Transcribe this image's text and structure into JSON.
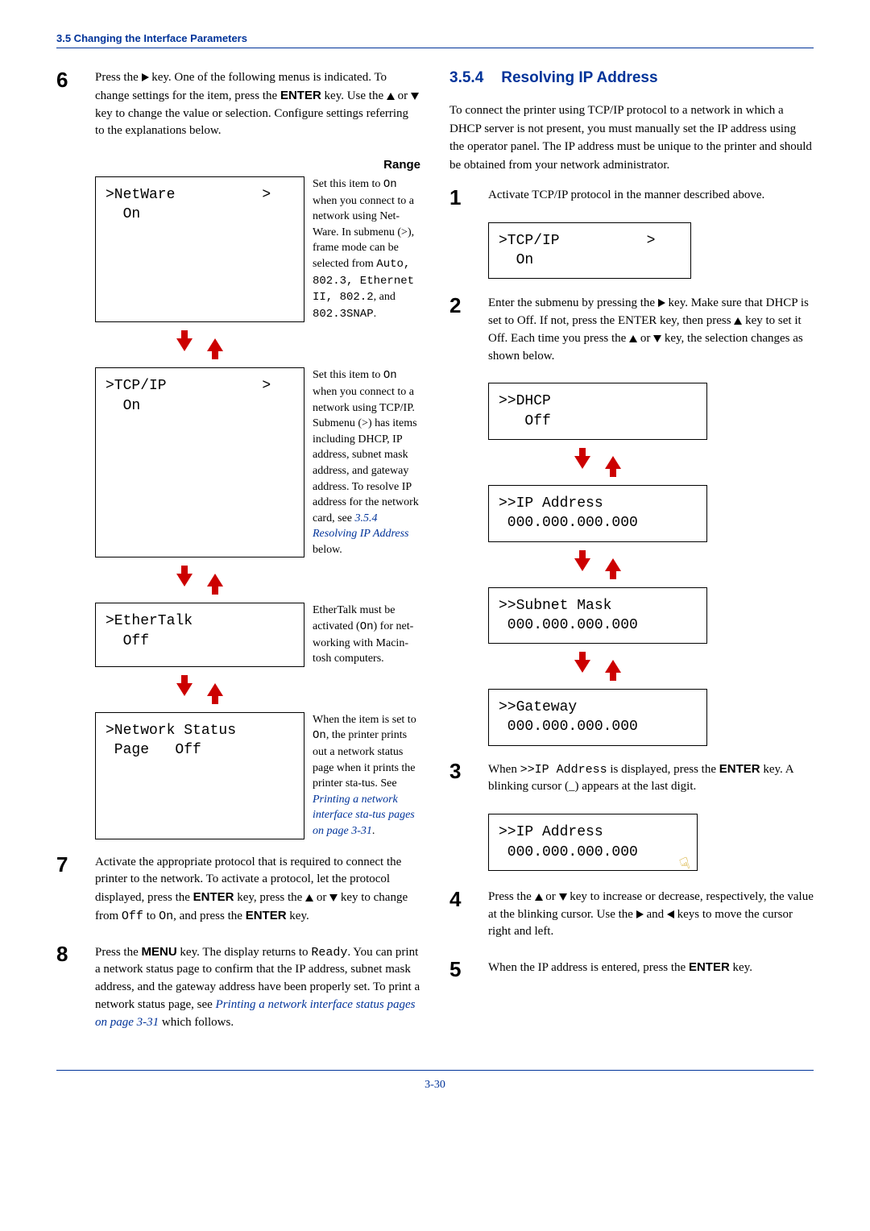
{
  "header": {
    "section": "3.5 Changing the Interface Parameters"
  },
  "left": {
    "step6": {
      "num": "6",
      "p1a": "Press the ",
      "p1b": " key. One of the following menus is indicated. To change settings for the item, press the ",
      "enter": "ENTER",
      "p1c": " key. Use the ",
      "p1d": " or ",
      "p1e": " key to change the value or  selection. Configure settings referring to the explanations below."
    },
    "range_label": "Range",
    "blocks": {
      "netware": {
        "line1": ">NetWare          >",
        "line2": "  On"
      },
      "netware_desc_a": "Set this item to ",
      "netware_on": "On",
      "netware_desc_b": " when you connect to a network using Net-Ware. In submenu (>), frame mode can be selected from ",
      "netware_opts": "Auto, 802.3, Ethernet II, 802.2",
      "netware_and": ", and ",
      "netware_snap": "802.3SNAP",
      "period": ".",
      "tcpip": {
        "line1": ">TCP/IP           >",
        "line2": "  On"
      },
      "tcpip_desc_a": "Set this item to ",
      "tcpip_on": "On",
      "tcpip_desc_b": " when you connect to a network using TCP/IP. Submenu (>) has items including DHCP, IP address, subnet mask address, and gateway address. To resolve IP address for the network card, see ",
      "tcpip_link": "3.5.4 Resolving IP Address",
      "tcpip_below": " below.",
      "ethertalk": {
        "line1": ">EtherTalk",
        "line2": "  Off"
      },
      "ethertalk_desc_a": "EtherTalk must be activated (",
      "ethertalk_on": "On",
      "ethertalk_desc_b": ") for net-working with Macin-tosh computers.",
      "netstat": {
        "line1": ">Network Status",
        "line2": " Page   Off"
      },
      "netstat_desc_a": "When the item is set to ",
      "netstat_on": "On",
      "netstat_desc_b": ", the printer prints out a network status page when it prints the printer sta-tus. See ",
      "netstat_link": "Printing a network interface sta-tus pages on page 3-31",
      "netstat_period": "."
    },
    "step7": {
      "num": "7",
      "p1a": "Activate the appropriate protocol that is required to connect the printer to the network. To activate a protocol, let the protocol displayed, press the ",
      "enter1": "ENTER",
      "p1b": " key, press the ",
      "p1c": " or ",
      "p1d": " key to change from ",
      "off": "Off",
      "to": " to ",
      "on": "On",
      "p1e": ", and press the ",
      "enter2": "ENTER",
      "p1f": " key."
    },
    "step8": {
      "num": "8",
      "p1a": "Press the ",
      "menu": "MENU",
      "p1b": " key. The display returns to ",
      "ready": "Ready",
      "p1c": ". You can print a network status page to confirm that the IP address, subnet mask address, and the gateway address have been properly set. To print a network status page, see ",
      "link": "Printing a network interface status pages on page 3-31",
      "p1d": " which follows."
    }
  },
  "right": {
    "heading_num": "3.5.4",
    "heading_text": "Resolving IP Address",
    "intro": "To connect the printer using TCP/IP protocol to a network in which a DHCP server is not present, you must manually set the IP address using the operator panel. The IP address must be unique to the printer and should be obtained from your network administrator.",
    "step1": {
      "num": "1",
      "text": "Activate TCP/IP protocol in the manner described above."
    },
    "lcd1": {
      "line1": ">TCP/IP          >",
      "line2": "  On"
    },
    "step2": {
      "num": "2",
      "a": "Enter the submenu by pressing the ",
      "b": " key. Make sure that DHCP is set to Off. If not, press the ENTER key, then press ",
      "c": " key to set it Off. Each time you press the ",
      "d": " or ",
      "e": " key, the selection changes as shown below."
    },
    "lcd_dhcp": {
      "line1": ">>DHCP",
      "line2": "   Off"
    },
    "lcd_ip": {
      "line1": ">>IP Address",
      "line2": " 000.000.000.000"
    },
    "lcd_mask": {
      "line1": ">>Subnet Mask",
      "line2": " 000.000.000.000"
    },
    "lcd_gw": {
      "line1": ">>Gateway",
      "line2": " 000.000.000.000"
    },
    "step3": {
      "num": "3",
      "a": "When ",
      "code": ">>IP Address",
      "b": " is displayed, press the ",
      "enter": "ENTER",
      "c": " key. A blinking cursor (_) appears at the last digit."
    },
    "lcd_ip2": {
      "line1": ">>IP Address",
      "line2": " 000.000.000.000"
    },
    "step4": {
      "num": "4",
      "a": "Press the ",
      "b": " or ",
      "c": " key to increase or decrease, respectively, the value at the blinking cursor. Use the ",
      "d": " and ",
      "e": " keys to move the cursor right and left."
    },
    "step5": {
      "num": "5",
      "a": "When the IP address is entered, press the ",
      "enter": "ENTER",
      "b": " key."
    }
  },
  "pagenum": "3-30"
}
